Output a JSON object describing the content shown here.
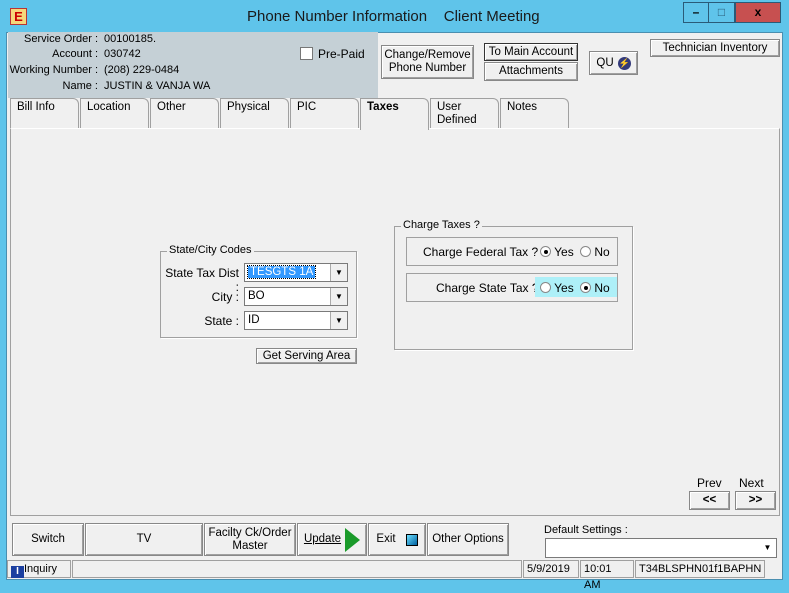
{
  "window": {
    "title": "Phone Number Information    Client Meeting",
    "app_icon": "E",
    "minimize": "–",
    "maximize": "□",
    "close": "x"
  },
  "header": {
    "fields": [
      {
        "label": "Service Order :",
        "value": "00100185."
      },
      {
        "label": "Account :",
        "value": "030742"
      },
      {
        "label": "Working Number :",
        "value": "(208) 229-0484"
      },
      {
        "label": "Name :",
        "value": "JUSTIN & VANJA WA"
      }
    ],
    "prepaid_label": "Pre-Paid",
    "prepaid_checked": false,
    "change_remove": "Change/Remove Phone Number",
    "to_main_account": "To Main Account",
    "attachments": "Attachments",
    "qu": "QU",
    "technician_inventory": "Technician Inventory"
  },
  "tabs": [
    {
      "label": "Bill Info"
    },
    {
      "label": "Location"
    },
    {
      "label": "Other"
    },
    {
      "label": "Physical"
    },
    {
      "label": "PIC"
    },
    {
      "label": "Taxes",
      "active": true
    },
    {
      "label": "User Defined"
    },
    {
      "label": "Notes"
    }
  ],
  "state_city": {
    "title": "State/City Codes",
    "state_tax_dist_label": "State Tax Dist :",
    "state_tax_dist": "TESGTS 1A",
    "city_label": "City :",
    "city": "BO",
    "state_label": "State :",
    "state": "ID",
    "get_serving_area": "Get Serving Area"
  },
  "charge_taxes": {
    "title": "Charge Taxes ?",
    "federal_label": "Charge Federal Tax ?",
    "federal": "Yes",
    "state_label": "Charge State Tax ?",
    "state": "No",
    "yes": "Yes",
    "no": "No"
  },
  "nav": {
    "prev": "Prev",
    "next": "Next",
    "prev_btn": "<<",
    "next_btn": ">>"
  },
  "bottom": {
    "switch": "Switch",
    "tv": "TV",
    "facility": "Facilty Ck/Order Master",
    "update": "Update",
    "exit": "Exit",
    "other_options": "Other Options",
    "default_settings_label": "Default Settings :",
    "default_settings": ""
  },
  "status": {
    "mode": "Inquiry",
    "date": "5/9/2019",
    "time": "10:01 AM",
    "terminal": "T34BLSPHN01f1BAPHN"
  },
  "colors": {
    "titlebar": "#5fc4ea",
    "header_bg": "#c5d0d6",
    "highlight": "#aef0f8",
    "selection": "#3399ff",
    "close": "#c75050"
  }
}
